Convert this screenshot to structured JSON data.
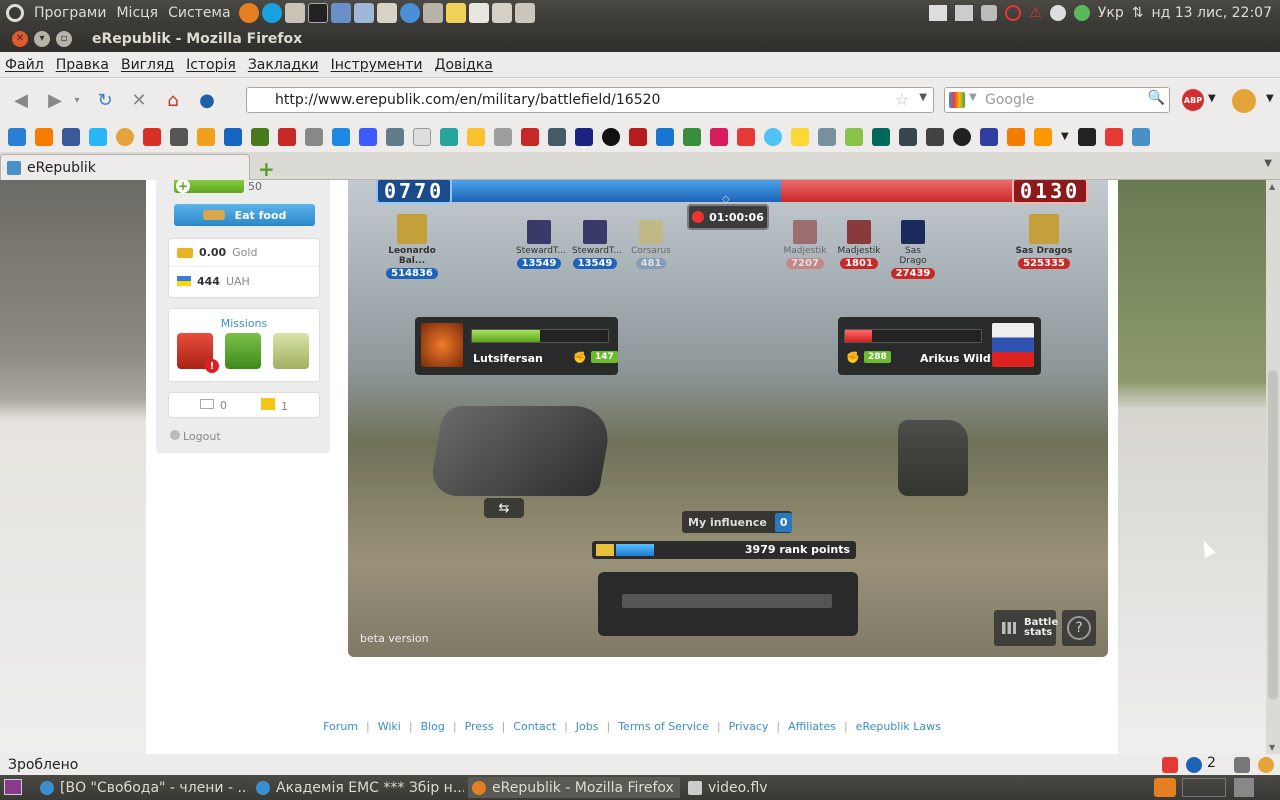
{
  "gnome_panel": {
    "menus": [
      "Програми",
      "Місця",
      "Система"
    ],
    "keyboard_layout": "Укр",
    "clock": "нд 13 лис, 22:07"
  },
  "window": {
    "title": "eRepublik - Mozilla Firefox"
  },
  "menubar": [
    "Файл",
    "Правка",
    "Вигляд",
    "Історія",
    "Закладки",
    "Інструменти",
    "Довідка"
  ],
  "navigation": {
    "url": "http://www.erepublik.com/en/military/battlefield/16520",
    "search_placeholder": "Google"
  },
  "tab": {
    "label": "eRepublik"
  },
  "sidebar": {
    "energy_value": "50",
    "eat_food_label": "Eat food",
    "gold_value": "0.00",
    "gold_label": "Gold",
    "currency_value": "444",
    "currency_label": "UAH",
    "missions_title": "Missions",
    "messages_count": "0",
    "alerts_count": "1",
    "logout_label": "Logout"
  },
  "battle": {
    "left_score": "0770",
    "right_score": "0130",
    "timer": "01:00:06",
    "left_heroes": [
      {
        "name": "Leonardo Bal...",
        "damage": "514836"
      },
      {
        "name": "StewardT...",
        "damage": "13549"
      },
      {
        "name": "StewardT...",
        "damage": "13549"
      },
      {
        "name": "Corsarus",
        "damage": "481"
      }
    ],
    "right_heroes": [
      {
        "name": "Madjestik",
        "damage": "7207"
      },
      {
        "name": "Madjestik",
        "damage": "1801"
      },
      {
        "name": "Sas Drago",
        "damage": "27439"
      },
      {
        "name": "Sas Dragos",
        "damage": "525335"
      }
    ],
    "left_fighter": {
      "name": "Lutsifersan",
      "level": "147",
      "health": 0.5
    },
    "right_fighter": {
      "name": "Arikus Wild",
      "level": "288",
      "health": 0.2
    },
    "influence_label": "My influence",
    "influence_value": "0",
    "rank_points": "3979 rank points",
    "rank_progress": 0.16,
    "beta_label": "beta version",
    "battle_stats_line1": "Battle",
    "battle_stats_line2": "stats",
    "help_symbol": "?"
  },
  "footer_links": [
    "Forum",
    "Wiki",
    "Blog",
    "Press",
    "Contact",
    "Jobs",
    "Terms of Service",
    "Privacy",
    "Affiliates",
    "eRepublik Laws"
  ],
  "statusbar": {
    "text": "Зроблено",
    "addon_count": "2"
  },
  "taskbar": [
    "[ВО \"Свобода\" - члени - ...",
    "Академія ЕМС *** Збір н...",
    "eRepublik - Mozilla Firefox",
    "video.flv"
  ],
  "colors": {
    "accent_blue": "#2b87c8",
    "enemy_red": "#c82828",
    "health_green": "#6cba2e"
  }
}
